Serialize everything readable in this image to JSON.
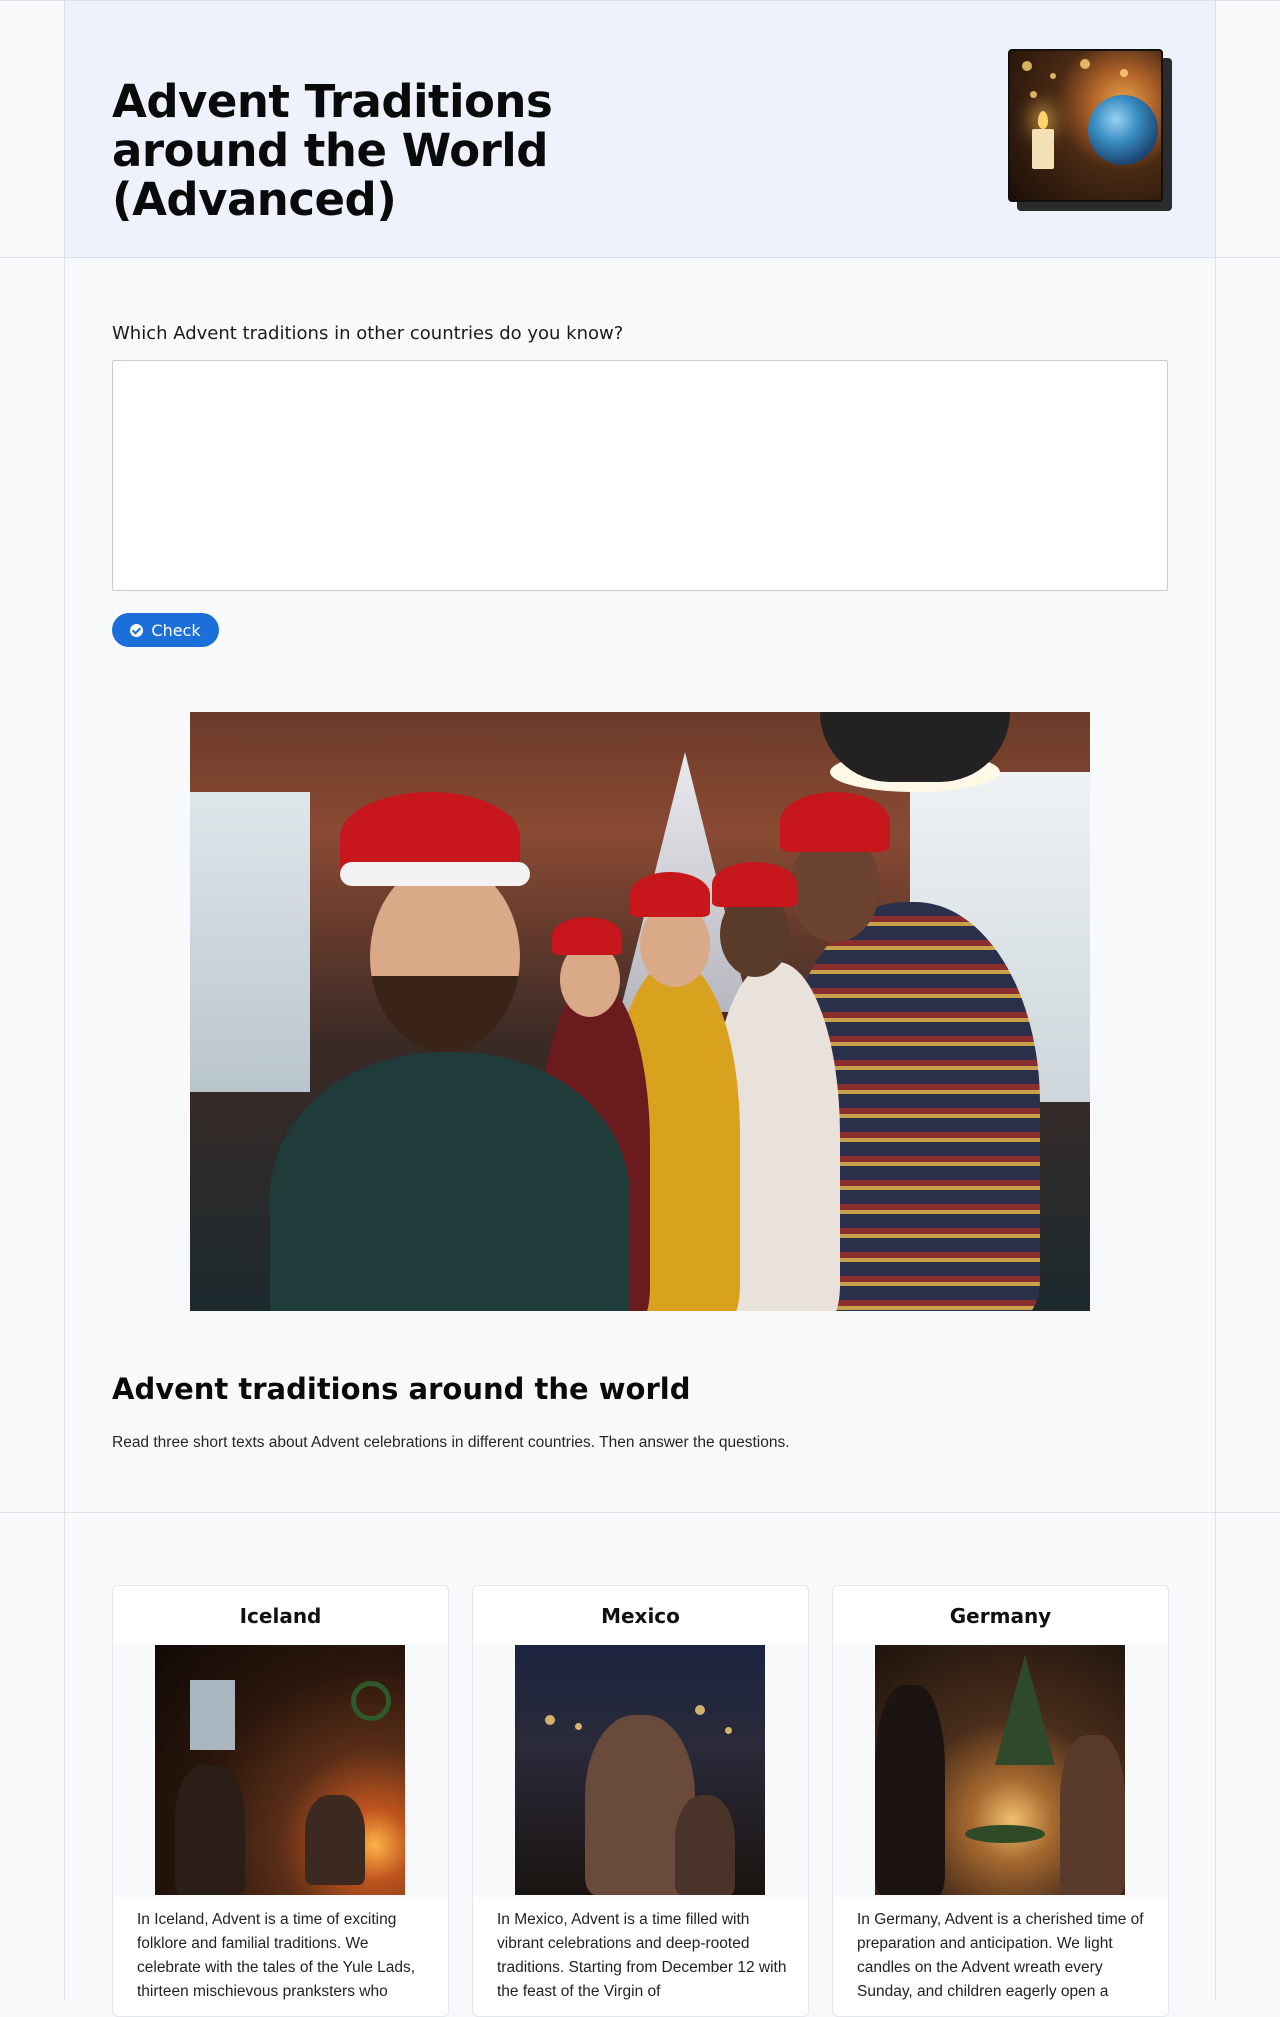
{
  "header": {
    "title": "Advent Traditions around the World (Advanced)",
    "thumbnail_icon": "advent-candle-globe-image"
  },
  "question": {
    "label": "Which Advent traditions in other countries do you know?",
    "answer_value": "",
    "check_label": "Check",
    "check_icon": "check-circle-icon"
  },
  "hero_image": "group-selfie-christmas-party-image",
  "section": {
    "heading": "Advent traditions around the world",
    "intro": "Read three short texts about Advent celebrations in different countries. Then answer the questions."
  },
  "cards": [
    {
      "title": "Iceland",
      "image": "family-by-fireplace-image",
      "text": "In Iceland, Advent is a time of exciting folklore and familial traditions. We celebrate with the tales of the Yule Lads, thirteen mischievous pranksters who"
    },
    {
      "title": "Mexico",
      "image": "candle-procession-image",
      "text": "In Mexico, Advent is a time filled with vibrant celebrations and deep-rooted traditions. Starting from December 12 with the feast of the Virgin of"
    },
    {
      "title": "Germany",
      "image": "advent-wreath-family-image",
      "text": "In Germany, Advent is a cherished time of preparation and anticipation. We light candles on the Advent wreath every Sunday, and children eagerly open a"
    }
  ],
  "colors": {
    "accent": "#1a6fd8",
    "header_bg": "#edf2fd",
    "page_bg": "#f8f9fb"
  }
}
